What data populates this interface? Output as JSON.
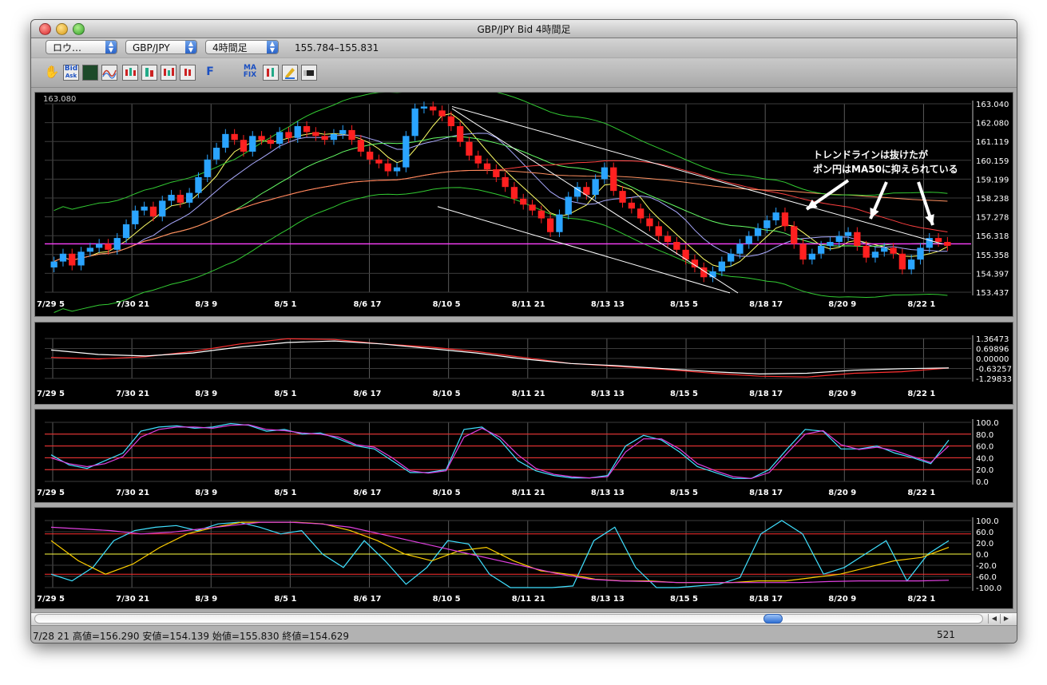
{
  "window": {
    "title": "GBP/JPY Bid 4時間足"
  },
  "toolbar": {
    "chart_type_label": "ロウ…",
    "symbol_label": "GBP/JPY",
    "timeframe_label": "4時間足",
    "price_range": "155.784–155.831",
    "buttons": [
      {
        "icon": "hand-icon"
      },
      {
        "icon": "bid-ask-icon",
        "label": "Bid"
      },
      {
        "icon": "indicator-icon"
      },
      {
        "icon": "oscillator-icon"
      },
      {
        "icon": "candle-tool-icon"
      },
      {
        "icon": "candle-tool-icon"
      },
      {
        "icon": "candle-tool-icon"
      },
      {
        "icon": "candle-tool-icon"
      },
      {
        "icon": "fix-icon",
        "label": "F"
      },
      {
        "icon": "ma-fix-icon",
        "label": "MA"
      },
      {
        "icon": "candle-tool-icon"
      },
      {
        "icon": "pencil-icon"
      },
      {
        "icon": "eraser-icon"
      }
    ]
  },
  "chart_data": [
    {
      "type": "candlestick",
      "title": "GBP/JPY Bid 4時間足",
      "top_left_label": "163.080",
      "x_tick_labels": [
        "7/29 5",
        "7/30 21",
        "8/3 9",
        "8/5 1",
        "8/6 17",
        "8/10 5",
        "8/11 21",
        "8/13 13",
        "8/15 5",
        "8/18 17",
        "8/20 9",
        "8/22 1"
      ],
      "y_tick_labels": [
        "163.040",
        "162.080",
        "161.119",
        "160.159",
        "159.199",
        "158.238",
        "157.278",
        "156.318",
        "155.358",
        "154.397",
        "153.437"
      ],
      "ylim": [
        153.437,
        163.04
      ],
      "annotation": [
        "トレンドラインは抜けたが",
        "ポン円はMA50に抑えられている"
      ],
      "closes": [
        155.0,
        155.4,
        154.8,
        155.5,
        155.7,
        155.9,
        155.6,
        156.2,
        156.9,
        157.6,
        157.8,
        157.3,
        158.1,
        158.4,
        158.0,
        158.5,
        159.3,
        160.2,
        160.8,
        161.5,
        161.2,
        160.6,
        161.4,
        161.2,
        161.0,
        161.6,
        161.3,
        161.9,
        161.6,
        161.4,
        161.2,
        161.5,
        161.7,
        161.2,
        160.6,
        160.2,
        160.0,
        159.6,
        159.8,
        161.4,
        162.8,
        162.9,
        162.7,
        162.4,
        161.9,
        161.1,
        160.4,
        160.0,
        159.7,
        159.3,
        158.8,
        158.2,
        157.9,
        157.6,
        157.2,
        156.5,
        157.4,
        158.3,
        158.8,
        158.4,
        159.2,
        159.8,
        158.6,
        158.0,
        157.7,
        157.2,
        156.8,
        156.3,
        156.0,
        155.6,
        155.1,
        154.7,
        154.2,
        154.5,
        155.0,
        155.4,
        155.9,
        156.3,
        156.7,
        157.1,
        157.5,
        156.8,
        155.9,
        155.1,
        155.4,
        155.8,
        156.0,
        156.3,
        156.5,
        155.8,
        155.2,
        155.5,
        155.7,
        155.4,
        154.6,
        155.1,
        155.7,
        156.2,
        156.0,
        155.8
      ],
      "trend_lines_y": [
        [
          162.9,
          155.9
        ],
        [
          157.8,
          153.4
        ],
        [
          162.8,
          153.4
        ]
      ]
    },
    {
      "type": "line",
      "x_tick_labels": [
        "7/29 5",
        "7/30 21",
        "8/3 9",
        "8/5 1",
        "8/6 17",
        "8/10 5",
        "8/11 21",
        "8/13 13",
        "8/15 5",
        "8/18 17",
        "8/20 9",
        "8/22 1"
      ],
      "y_tick_labels": [
        "1.36473",
        "0.69896",
        "0.00000",
        "-0.63257",
        "-1.29833"
      ],
      "ylim": [
        -1.29833,
        1.36473
      ],
      "series": [
        {
          "color": "#ff3030",
          "values": [
            0.1,
            0.0,
            0.15,
            0.5,
            1.0,
            1.35,
            1.3,
            1.0,
            0.8,
            0.5,
            0.1,
            -0.3,
            -0.5,
            -0.7,
            -0.95,
            -1.15,
            -1.2,
            -0.95,
            -0.85,
            -0.6
          ]
        },
        {
          "color": "#ffffff",
          "values": [
            0.6,
            0.3,
            0.2,
            0.4,
            0.8,
            1.1,
            1.2,
            1.0,
            0.7,
            0.4,
            0.0,
            -0.3,
            -0.45,
            -0.65,
            -0.85,
            -1.0,
            -0.95,
            -0.75,
            -0.65,
            -0.6
          ]
        }
      ]
    },
    {
      "type": "line",
      "x_tick_labels": [
        "7/29 5",
        "7/30 21",
        "8/3 9",
        "8/5 1",
        "8/6 17",
        "8/10 5",
        "8/11 21",
        "8/13 13",
        "8/15 5",
        "8/18 17",
        "8/20 9",
        "8/22 1"
      ],
      "y_tick_labels": [
        "100.0",
        "80.0",
        "60.0",
        "40.0",
        "20.0",
        "0.0"
      ],
      "ylim": [
        0,
        100
      ],
      "series": [
        {
          "color": "#40e0ff",
          "values": [
            45,
            28,
            22,
            35,
            48,
            85,
            92,
            94,
            90,
            92,
            98,
            95,
            85,
            88,
            80,
            82,
            72,
            60,
            55,
            35,
            15,
            15,
            20,
            88,
            92,
            70,
            35,
            18,
            10,
            6,
            6,
            10,
            60,
            78,
            70,
            50,
            25,
            15,
            5,
            5,
            20,
            55,
            88,
            85,
            55,
            55,
            60,
            48,
            40,
            30,
            70
          ]
        },
        {
          "color": "#e040e0",
          "values": [
            40,
            30,
            25,
            30,
            42,
            75,
            88,
            92,
            92,
            90,
            95,
            96,
            88,
            86,
            82,
            80,
            75,
            62,
            58,
            40,
            18,
            14,
            18,
            75,
            90,
            75,
            45,
            22,
            12,
            8,
            6,
            8,
            50,
            72,
            72,
            55,
            30,
            18,
            8,
            5,
            15,
            48,
            80,
            86,
            62,
            54,
            58,
            52,
            42,
            32,
            60
          ]
        }
      ]
    },
    {
      "type": "line",
      "x_tick_labels": [
        "7/29 5",
        "7/30 21",
        "8/3 9",
        "8/5 1",
        "8/6 17",
        "8/10 5",
        "8/11 21",
        "8/13 13",
        "8/15 5",
        "8/18 17",
        "8/20 9",
        "8/22 1"
      ],
      "y_tick_labels": [
        "100.0",
        "60.0",
        "20.0",
        "0.0",
        "-20.0",
        "-60.0",
        "-100.0"
      ],
      "ylim": [
        -100,
        100
      ],
      "series": [
        {
          "color": "#40e0ff",
          "values": [
            -60,
            -80,
            -40,
            40,
            70,
            80,
            85,
            70,
            90,
            95,
            80,
            60,
            70,
            0,
            -40,
            40,
            -20,
            -90,
            -40,
            40,
            30,
            -60,
            -100,
            -100,
            -100,
            -95,
            40,
            80,
            -40,
            -100,
            -100,
            -95,
            -90,
            -70,
            60,
            100,
            60,
            -60,
            -40,
            0,
            40,
            -80,
            0,
            40
          ]
        },
        {
          "color": "#ffd000",
          "values": [
            40,
            -20,
            -60,
            -30,
            20,
            60,
            80,
            95,
            95,
            95,
            90,
            70,
            40,
            0,
            -20,
            10,
            20,
            -20,
            -50,
            -60,
            -75,
            -80,
            -80,
            -85,
            -85,
            -85,
            -80,
            -80,
            -70,
            -60,
            -40,
            -20,
            -10,
            20
          ]
        },
        {
          "color": "#e040e0",
          "values": [
            80,
            75,
            70,
            60,
            65,
            75,
            85,
            95,
            95,
            90,
            80,
            60,
            40,
            20,
            0,
            -20,
            -40,
            -60,
            -75,
            -80,
            -82,
            -85,
            -85,
            -85,
            -85,
            -85,
            -82,
            -80,
            -80,
            -80,
            -78
          ]
        }
      ]
    }
  ],
  "statusbar": {
    "ohlc": "7/28 21  高値=156.290 安値=154.139 始値=155.830 終値=154.629",
    "count": "521"
  }
}
